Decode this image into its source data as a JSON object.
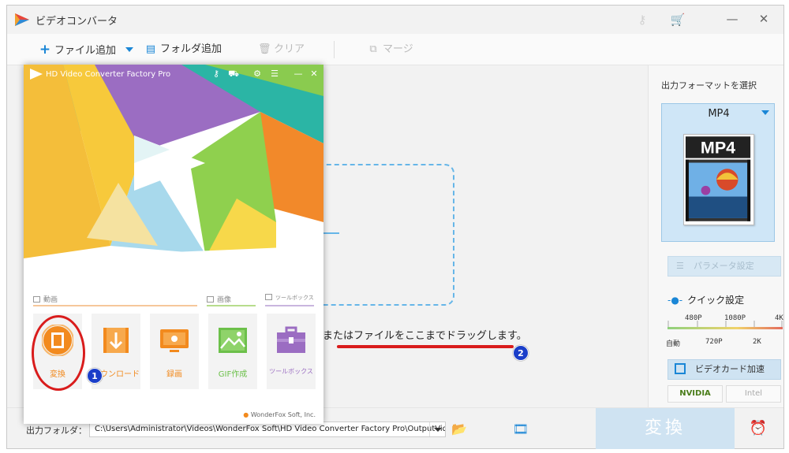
{
  "app": {
    "title": "ビデオコンバータ"
  },
  "toolbar": {
    "add_file": "ファイル追加",
    "add_folder": "フォルダ追加",
    "clear": "クリア",
    "merge": "マージ"
  },
  "content": {
    "drag_hint": "またはファイルをここまでドラッグします。"
  },
  "right_panel": {
    "title": "出力フォーマットを選択",
    "format": "MP4",
    "thumb_text": "MP4",
    "param_button": "パラメータ設定",
    "quick_title": "クイック設定",
    "scale_top": [
      "480P",
      "1080P",
      "4K"
    ],
    "scale_bottom": [
      "自動",
      "720P",
      "2K"
    ],
    "gpu_button": "ビデオカード加速",
    "vendor_nvidia": "NVIDIA",
    "vendor_intel": "Intel"
  },
  "bottom": {
    "output_label": "出力フォルダ：",
    "output_path": "C:\\Users\\Administrator\\Videos\\WonderFox Soft\\HD Video Converter Factory Pro\\OutputVideo\\",
    "convert_button": "変換"
  },
  "overlay": {
    "title": "HD Video Converter Factory Pro",
    "sections": [
      "動画",
      "画像",
      "ツールボックス"
    ],
    "tiles": [
      "変換",
      "ダウンロード",
      "録画",
      "GIF作成",
      "ツールボックス"
    ],
    "footer": "WonderFox Soft, Inc."
  },
  "annotations": {
    "badge1": "1",
    "badge2": "2"
  },
  "colors": {
    "accent": "#1a86d6",
    "orange": "#f28a1e",
    "annotation_red": "#d91c1c",
    "badge_blue": "#1a3ec9"
  }
}
